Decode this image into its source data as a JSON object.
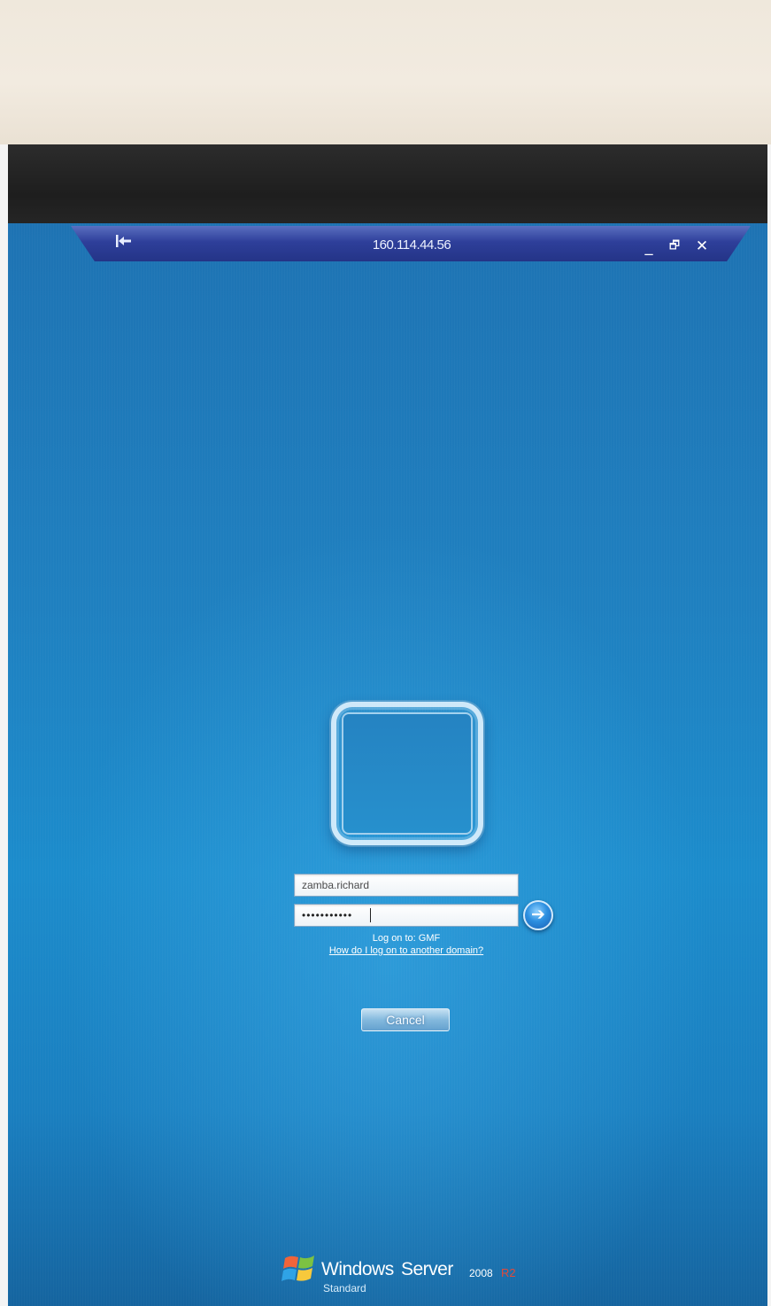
{
  "connection_bar": {
    "title": "160.114.44.56",
    "pin_icon": "pin-icon",
    "minimize_glyph": "_",
    "restore_glyph": "🗗",
    "close_glyph": "✕"
  },
  "logon": {
    "username_value": "zamba.richard",
    "password_mask": "•••••••••••",
    "go_glyph": "➔",
    "log_on_to": "Log on to: GMF",
    "other_domain_link": "How do I log on to another domain?",
    "cancel_label": "Cancel"
  },
  "brand": {
    "windows": "Windows",
    "server": "Server",
    "year": "2008",
    "release": "R2",
    "edition": "Standard"
  },
  "colors": {
    "screen_blue": "#1f80c0",
    "connection_bar": "#2e3f9a",
    "r2_accent": "#e24a3a",
    "bezel": "#1e1e1e"
  }
}
